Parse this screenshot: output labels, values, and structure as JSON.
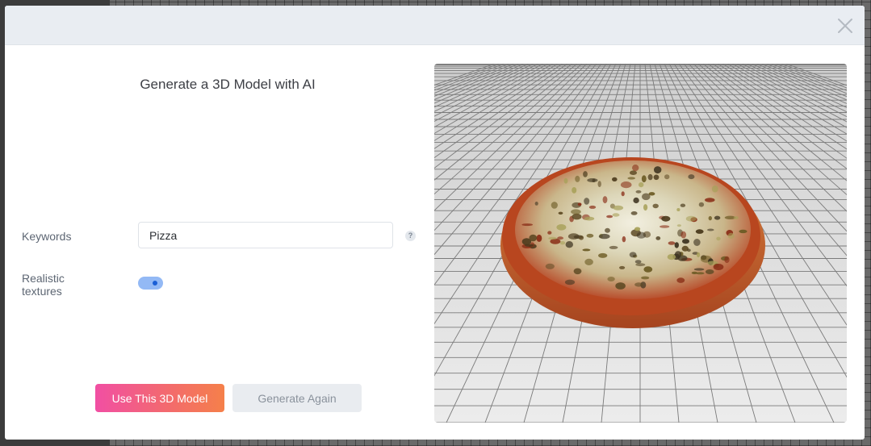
{
  "modal": {
    "title": "Generate a 3D Model with AI",
    "close_icon": "close-icon"
  },
  "form": {
    "keywords_label": "Keywords",
    "keywords_value": "Pizza",
    "help_icon_text": "?",
    "textures_label": "Realistic textures",
    "textures_enabled": true
  },
  "buttons": {
    "use_label": "Use This 3D Model",
    "generate_label": "Generate Again"
  },
  "viewer": {
    "model_name": "pizza-3d-model"
  },
  "colors": {
    "accent_gradient_start": "#f14fa3",
    "accent_gradient_end": "#f5804a",
    "toggle_on": "#93b9f5"
  }
}
